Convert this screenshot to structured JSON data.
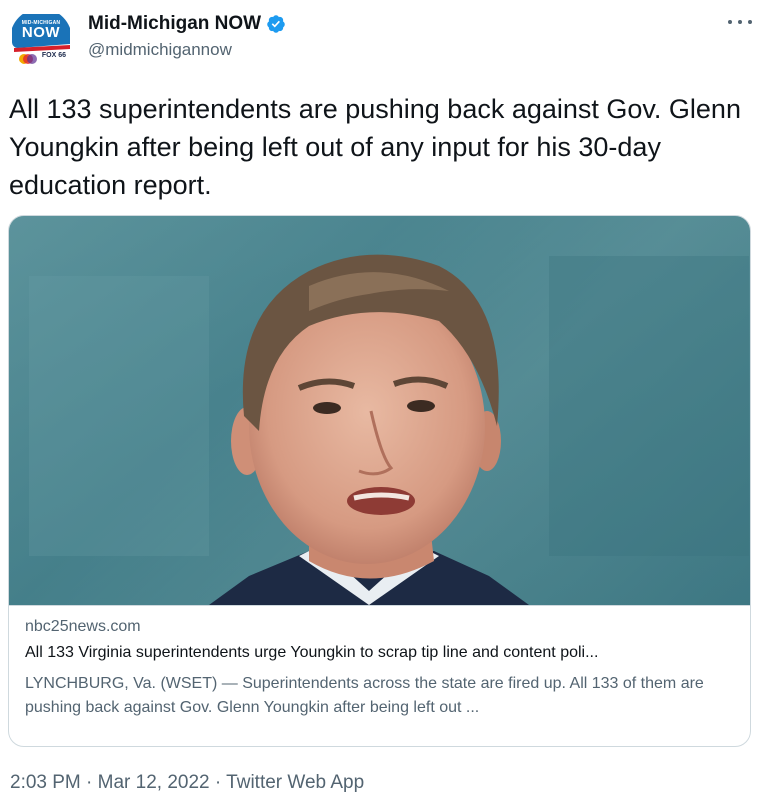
{
  "author": {
    "display_name": "Mid-Michigan NOW",
    "handle": "@midmichigannow",
    "verified": true,
    "avatar": {
      "line1": "MID-MICHIGAN",
      "line2": "NOW",
      "line3": "FOX 66",
      "brand_color": "#1a73b8",
      "accent_color": "#d6202a"
    }
  },
  "tweet": {
    "text": "All 133 superintendents are pushing back against Gov. Glenn Youngkin after being left out of any input for his 30-day education report."
  },
  "card": {
    "image_icon": "photo-portrait",
    "domain": "nbc25news.com",
    "title": "All 133 Virginia superintendents urge Youngkin to scrap tip line and content poli...",
    "description": "LYNCHBURG, Va. (WSET) — Superintendents across the state are fired up. All 133 of them are pushing back against Gov. Glenn Youngkin after being left out ..."
  },
  "footer": {
    "time": "2:03 PM",
    "separator": "·",
    "date": "Mar 12, 2022",
    "source": "Twitter Web App"
  },
  "icons": {
    "verified": "verified-badge-icon",
    "more": "more-options-icon"
  },
  "colors": {
    "verified_blue": "#1d9bf0",
    "secondary_text": "#536471",
    "primary_text": "#0f1419",
    "border": "#cfd9de"
  }
}
